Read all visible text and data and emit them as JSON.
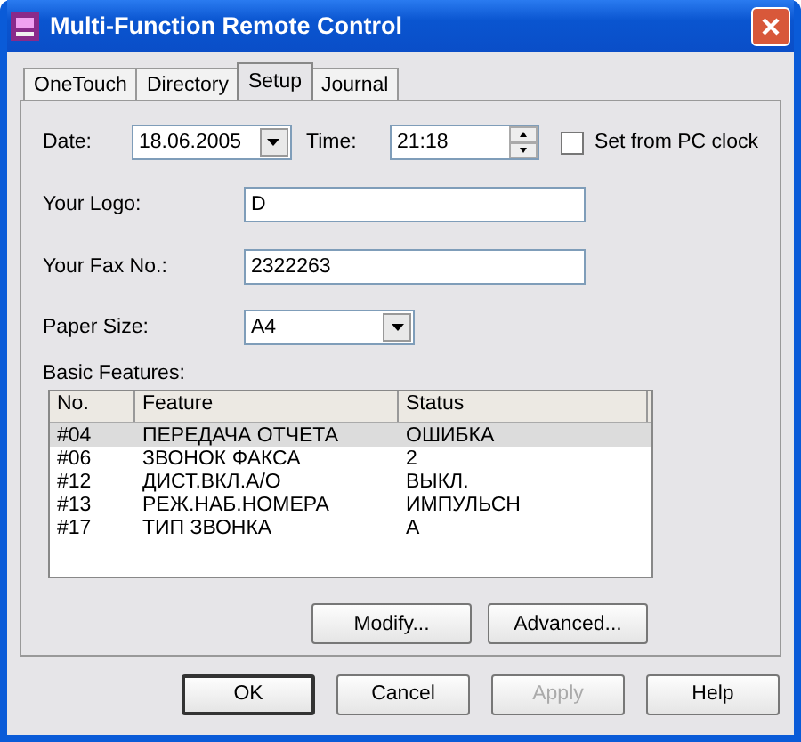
{
  "window": {
    "title": "Multi-Function Remote Control"
  },
  "tabs": [
    {
      "label": "OneTouch",
      "selected": false
    },
    {
      "label": "Directory",
      "selected": false
    },
    {
      "label": "Setup",
      "selected": true
    },
    {
      "label": "Journal",
      "selected": false
    }
  ],
  "date": {
    "label": "Date:",
    "value": "18.06.2005"
  },
  "time": {
    "label": "Time:",
    "value": "21:18"
  },
  "pc_clock": {
    "label": "Set from PC clock",
    "checked": false
  },
  "logo": {
    "label": "Your Logo:",
    "value": "D"
  },
  "fax": {
    "label": "Your Fax No.:",
    "value": "2322263"
  },
  "paper": {
    "label": "Paper Size:",
    "value": "A4"
  },
  "features": {
    "label": "Basic Features:",
    "columns": [
      "No.",
      "Feature",
      "Status"
    ],
    "rows": [
      {
        "no": "#04",
        "feature": "ПЕРЕДАЧА ОТЧЕТА",
        "status": "ОШИБКА",
        "selected": true
      },
      {
        "no": "#06",
        "feature": "ЗВОНОК ФАКСА",
        "status": "2",
        "selected": false
      },
      {
        "no": "#12",
        "feature": "ДИСТ.ВКЛ.А/О",
        "status": "ВЫКЛ.",
        "selected": false
      },
      {
        "no": "#13",
        "feature": "РЕЖ.НАБ.НОМЕРА",
        "status": "ИМПУЛЬСН",
        "selected": false
      },
      {
        "no": "#17",
        "feature": "ТИП ЗВОНКА",
        "status": "А",
        "selected": false
      }
    ],
    "buttons": [
      "Modify...",
      "Advanced..."
    ]
  },
  "buttons": [
    {
      "label": "OK",
      "disabled": false,
      "default": true
    },
    {
      "label": "Cancel",
      "disabled": false,
      "default": false
    },
    {
      "label": "Apply",
      "disabled": true,
      "default": false
    },
    {
      "label": "Help",
      "disabled": false,
      "default": false
    }
  ]
}
